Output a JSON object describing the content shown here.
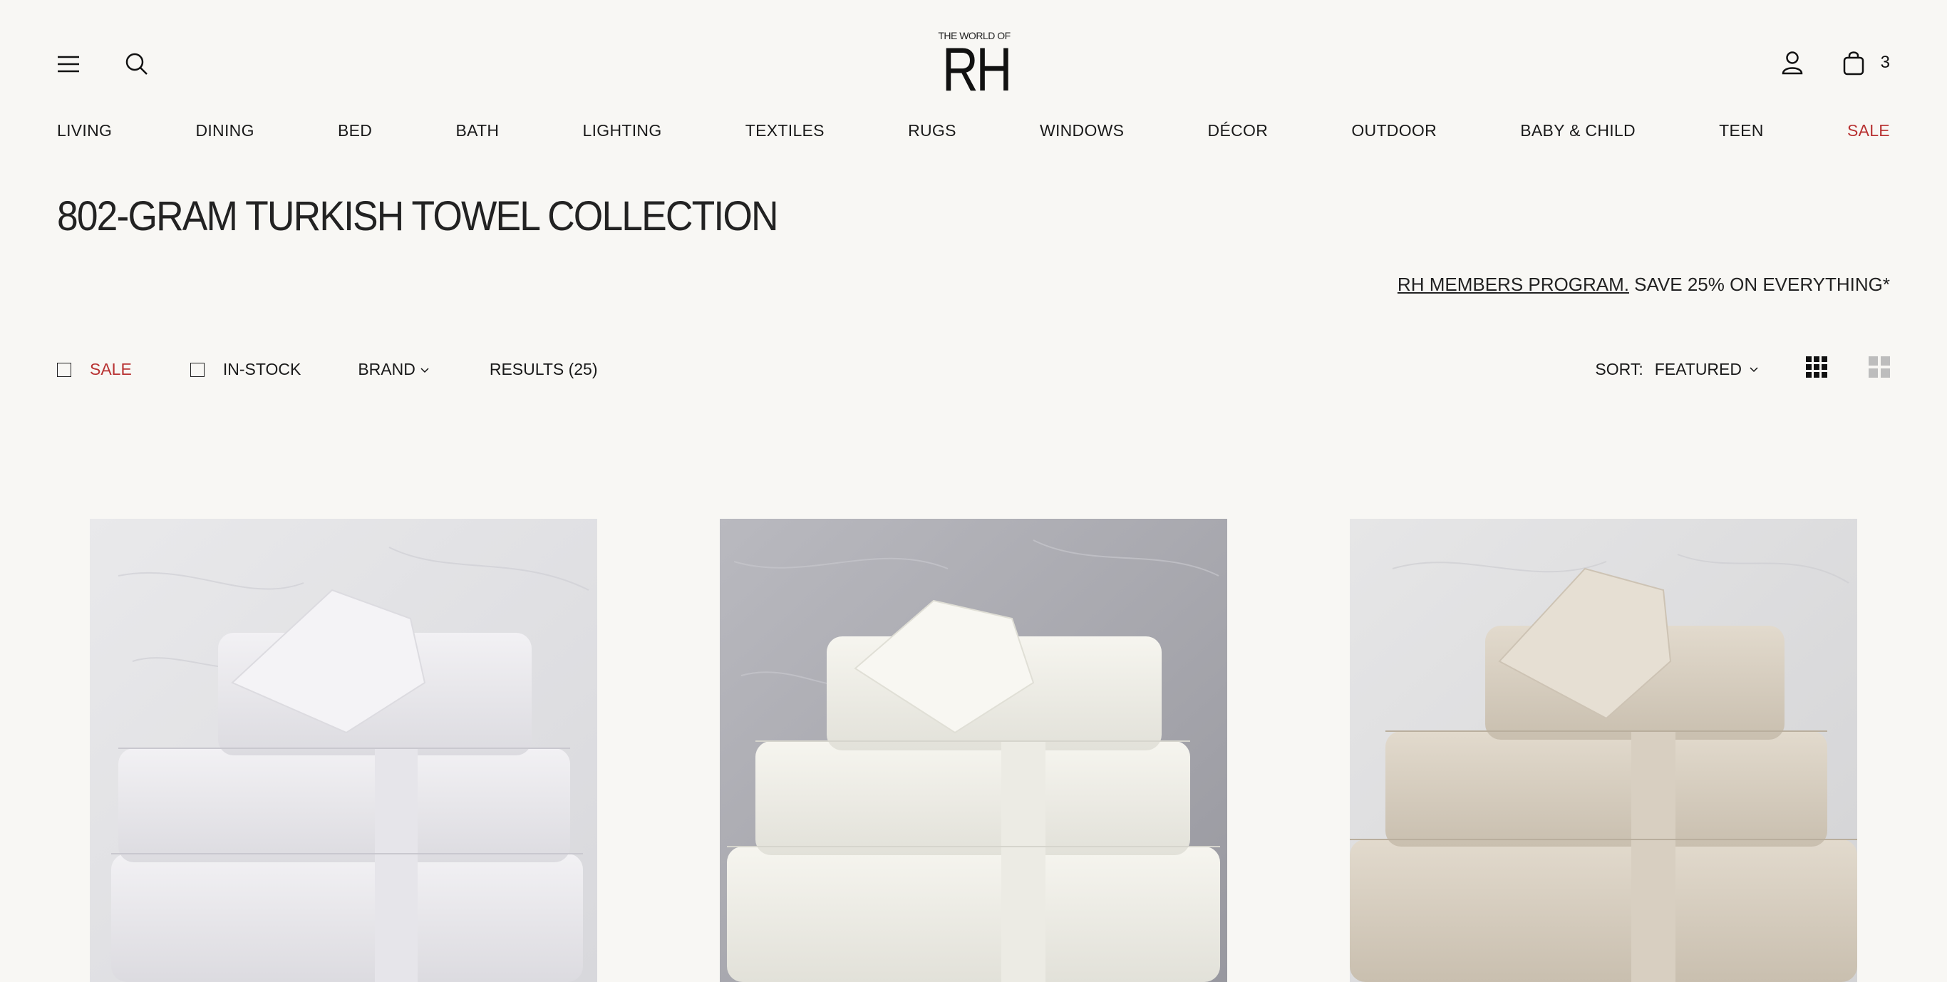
{
  "header": {
    "menu_icon": "hamburger-icon",
    "search_icon": "search-icon",
    "logo_small": "THE WORLD OF",
    "logo_big": "RH",
    "account_icon": "user-icon",
    "cart_icon": "shopping-bag-icon",
    "cart_count": "3"
  },
  "nav": {
    "items": [
      {
        "label": "LIVING"
      },
      {
        "label": "DINING"
      },
      {
        "label": "BED"
      },
      {
        "label": "BATH"
      },
      {
        "label": "LIGHTING"
      },
      {
        "label": "TEXTILES"
      },
      {
        "label": "RUGS"
      },
      {
        "label": "WINDOWS"
      },
      {
        "label": "DÉCOR"
      },
      {
        "label": "OUTDOOR"
      },
      {
        "label": "BABY & CHILD"
      },
      {
        "label": "TEEN"
      },
      {
        "label": "SALE"
      }
    ],
    "sale_color": "#b83232"
  },
  "page": {
    "title": "802-GRAM TURKISH TOWEL COLLECTION",
    "promo_link": "RH MEMBERS PROGRAM.",
    "promo_text": " SAVE 25% ON EVERYTHING*"
  },
  "filters": {
    "sale_label": "SALE",
    "instock_label": "IN-STOCK",
    "brand_label": "BRAND",
    "results_label": "RESULTS (25)",
    "sort_label": "SORT:",
    "sort_value": "FEATURED"
  },
  "products": [
    {
      "image": "white-towel-stack",
      "towel_color": "#ecebee",
      "bg_color": "#e3e3e5"
    },
    {
      "image": "ivory-towel-stack",
      "towel_color": "#f1f0e9",
      "bg_color": "#a9a9af"
    },
    {
      "image": "sand-towel-stack",
      "towel_color": "#d9d0c2",
      "bg_color": "#dededf"
    }
  ]
}
